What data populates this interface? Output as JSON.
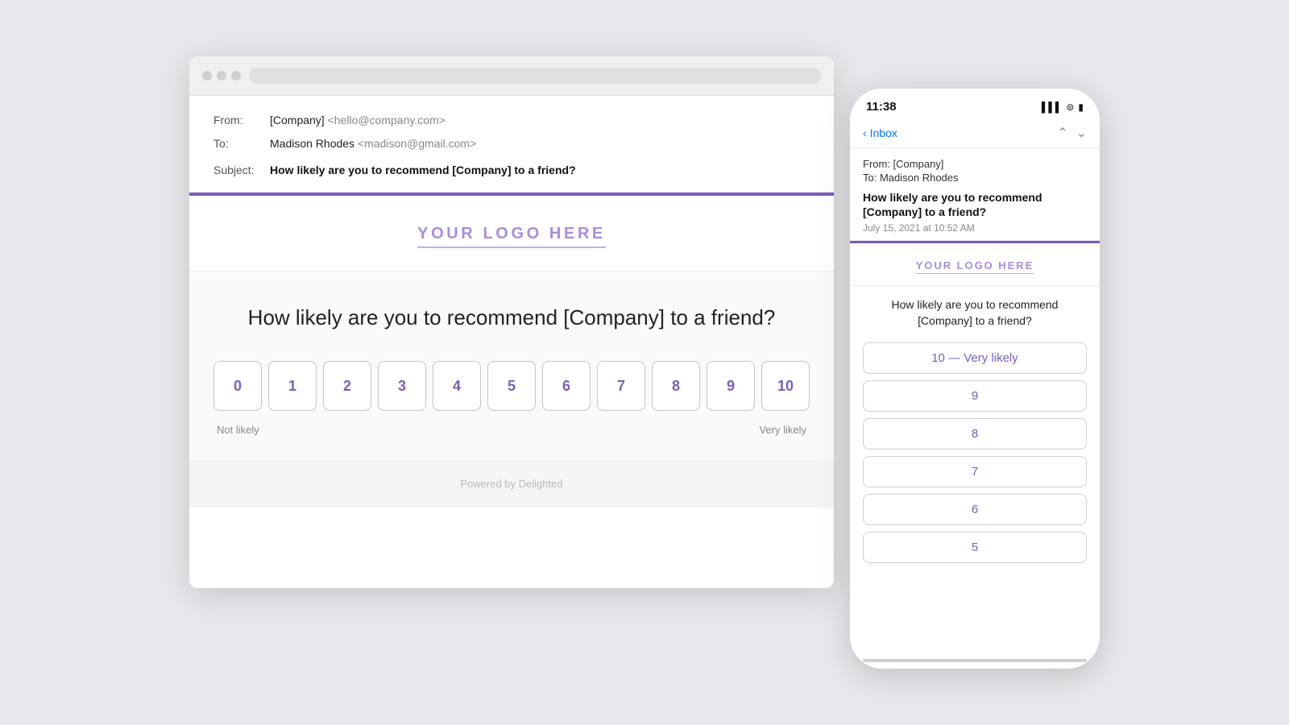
{
  "background_color": "#e8e8ec",
  "accent_color": "#7c5cbf",
  "browser": {
    "dots": [
      "#d0d0d0",
      "#d0d0d0",
      "#d0d0d0"
    ],
    "email": {
      "from_label": "From:",
      "from_name": "[Company]",
      "from_email": "<hello@company.com>",
      "to_label": "To:",
      "to_name": "Madison Rhodes",
      "to_email": "<madison@gmail.com>",
      "subject_label": "Subject:",
      "subject_text": "How likely are you to recommend [Company] to a friend?",
      "logo_text": "YOUR LOGO HERE",
      "question": "How likely are you to recommend [Company] to a friend?",
      "nps_scores": [
        "0",
        "1",
        "2",
        "3",
        "4",
        "5",
        "6",
        "7",
        "8",
        "9",
        "10"
      ],
      "label_low": "Not likely",
      "label_high": "Very likely",
      "footer_text": "Powered by Delighted"
    }
  },
  "mobile": {
    "time": "11:38",
    "back_label": "Inbox",
    "from_text": "From: [Company]",
    "to_text": "To: Madison Rhodes",
    "subject_text": "How likely are you to recommend [Company] to a friend?",
    "date_text": "July 15, 2021 at 10:52 AM",
    "logo_text": "YOUR LOGO HERE",
    "question": "How likely are you to recommend [Company] to a friend?",
    "nps_items": [
      "10 — Very likely",
      "9",
      "8",
      "7",
      "6",
      "5"
    ]
  }
}
